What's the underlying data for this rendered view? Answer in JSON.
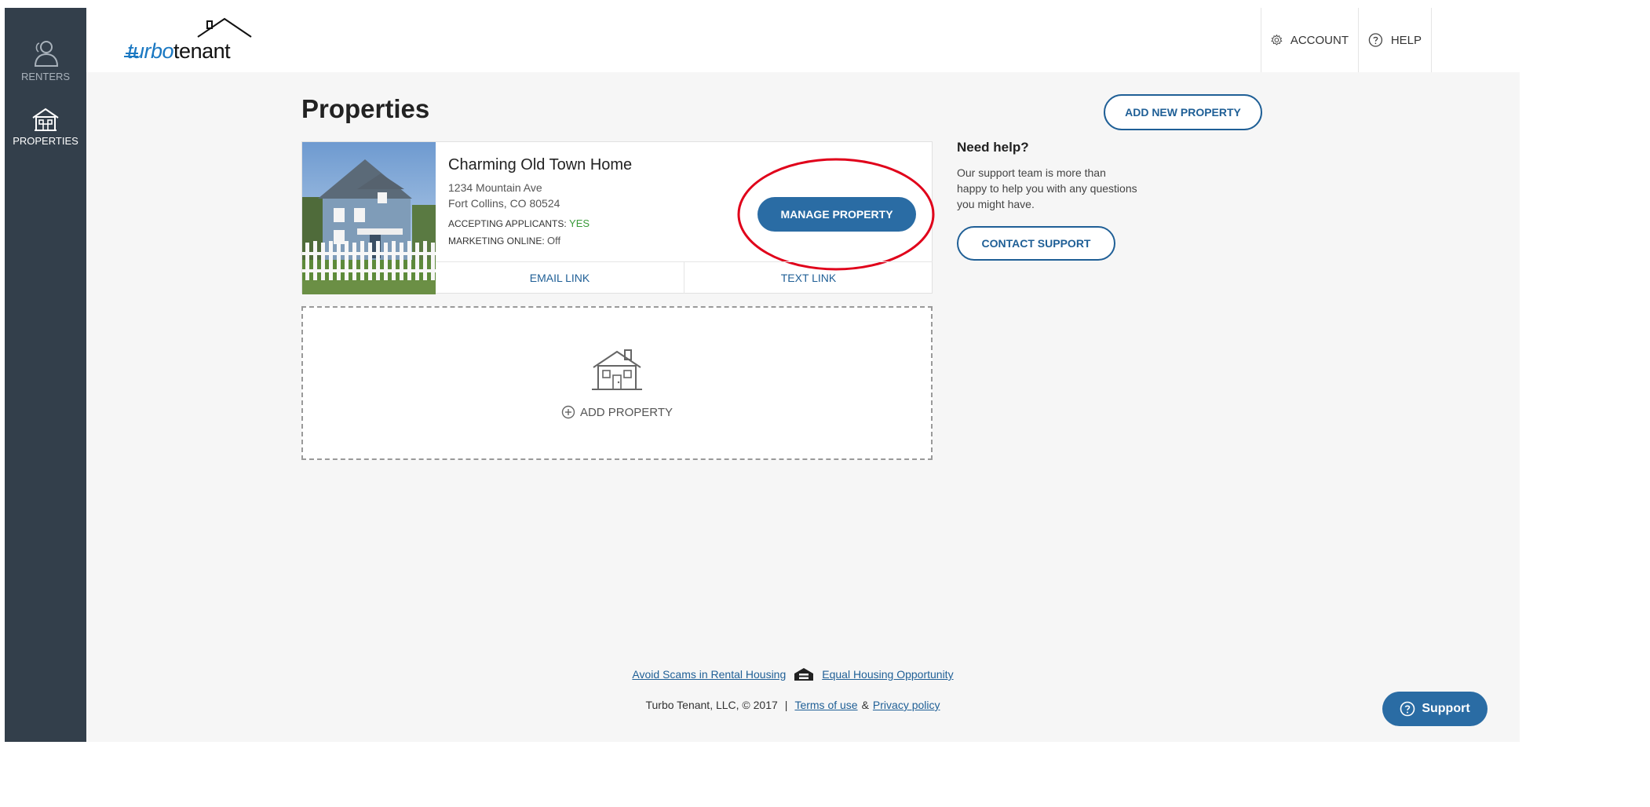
{
  "sidebar": {
    "items": [
      {
        "label": "RENTERS",
        "icon": "users-icon"
      },
      {
        "label": "PROPERTIES",
        "icon": "house-icon"
      }
    ]
  },
  "header": {
    "logo": {
      "turbo": "turbo",
      "tenant": "tenant"
    },
    "account_label": "ACCOUNT",
    "help_label": "HELP"
  },
  "main": {
    "title": "Properties",
    "add_new_label": "ADD NEW PROPERTY",
    "property": {
      "name": "Charming Old Town Home",
      "address_line1": "1234 Mountain Ave",
      "address_line2": "Fort Collins, CO 80524",
      "accepting_label": "ACCEPTING APPLICANTS:",
      "accepting_value": "YES",
      "marketing_label": "MARKETING ONLINE:",
      "marketing_value": "Off",
      "manage_label": "MANAGE PROPERTY",
      "email_link_label": "EMAIL LINK",
      "text_link_label": "TEXT LINK"
    },
    "add_property_label": "ADD PROPERTY"
  },
  "help_panel": {
    "title": "Need help?",
    "text": "Our support team is more than happy to help you with any questions you might have.",
    "contact_label": "CONTACT SUPPORT"
  },
  "footer": {
    "avoid_scams": "Avoid Scams in Rental Housing",
    "equal_housing": "Equal Housing Opportunity",
    "copyright": "Turbo Tenant, LLC, © 2017",
    "separator": "|",
    "terms": "Terms of use",
    "amp": "&",
    "privacy": "Privacy policy"
  },
  "support_widget": {
    "label": "Support"
  },
  "colors": {
    "sidebar_bg": "#333f4b",
    "primary_blue": "#2a6ca4",
    "accent_green": "#3a9a3a",
    "highlight_red": "#e0001a"
  }
}
